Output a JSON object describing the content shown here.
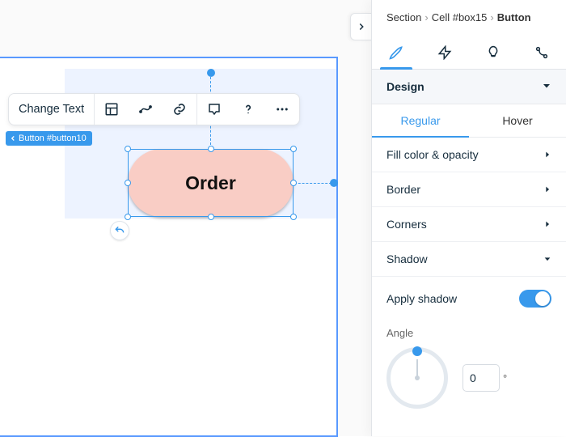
{
  "toolbar": {
    "change_text": "Change Text"
  },
  "badge": {
    "label": "Button #button10"
  },
  "canvas_button": {
    "label": "Order"
  },
  "breadcrumb": {
    "a": "Section",
    "b": "Cell #box15",
    "c": "Button"
  },
  "panel": {
    "design_header": "Design",
    "subtabs": {
      "regular": "Regular",
      "hover": "Hover"
    },
    "rows": {
      "fill": "Fill color & opacity",
      "border": "Border",
      "corners": "Corners",
      "shadow": "Shadow"
    },
    "apply_shadow": "Apply shadow",
    "apply_shadow_on": true,
    "angle": {
      "label": "Angle",
      "value": "0",
      "unit": "°"
    }
  }
}
